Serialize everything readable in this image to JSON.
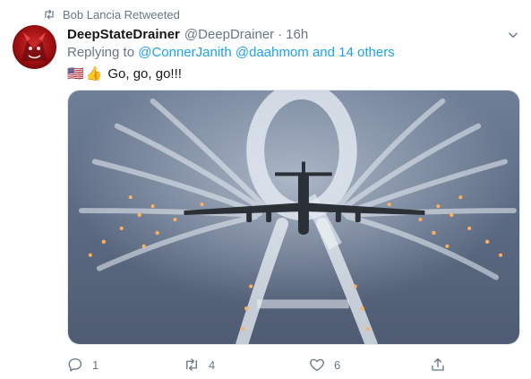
{
  "retweet": {
    "label": "Bob Lancia Retweeted"
  },
  "tweet": {
    "name": "DeepStateDrainer",
    "handle": "@DeepDrainer",
    "separator": "·",
    "time": "16h",
    "replying_prefix": "Replying to ",
    "replying_user_1": "@ConnerJanith",
    "replying_user_2": "@daahmom",
    "replying_conj": " and ",
    "replying_others": "14 others",
    "emoji_flag": "🇺🇸",
    "emoji_hand": "👍",
    "text": "Go, go, go!!!"
  },
  "stats": {
    "replies": "1",
    "retweets": "4",
    "likes": "6"
  },
  "icons": {
    "retweet": "retweet-icon",
    "caret": "chevron-down-icon",
    "reply": "reply-icon",
    "like": "heart-icon",
    "share": "share-icon"
  },
  "colors": {
    "link": "#1da1f2",
    "secondary": "#657786",
    "text": "#14171a"
  }
}
